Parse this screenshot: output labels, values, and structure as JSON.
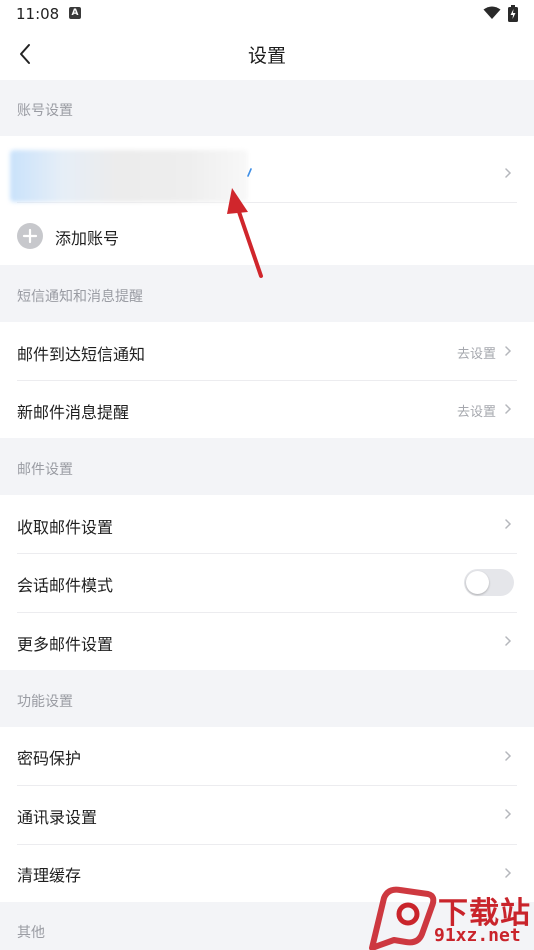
{
  "status_bar": {
    "time": "11:08",
    "notification_badge": "A"
  },
  "header": {
    "title": "设置"
  },
  "sections": {
    "account": {
      "header": "账号设置",
      "add_account_label": "添加账号"
    },
    "sms": {
      "header": "短信通知和消息提醒",
      "items": [
        {
          "label": "邮件到达短信通知",
          "hint": "去设置"
        },
        {
          "label": "新邮件消息提醒",
          "hint": "去设置"
        }
      ]
    },
    "mail": {
      "header": "邮件设置",
      "items": [
        {
          "label": "收取邮件设置"
        },
        {
          "label": "会话邮件模式",
          "toggle_on": false
        },
        {
          "label": "更多邮件设置"
        }
      ]
    },
    "function": {
      "header": "功能设置",
      "items": [
        {
          "label": "密码保护"
        },
        {
          "label": "通讯录设置"
        },
        {
          "label": "清理缓存"
        }
      ]
    },
    "other": {
      "header": "其他"
    }
  },
  "watermark": {
    "logo_text": "下载站",
    "site": "91xz.net"
  },
  "colors": {
    "background": "#f3f4f7",
    "section_header": "#9a9ca3",
    "annotation_arrow": "#d0262c",
    "watermark": "#c9242b"
  }
}
